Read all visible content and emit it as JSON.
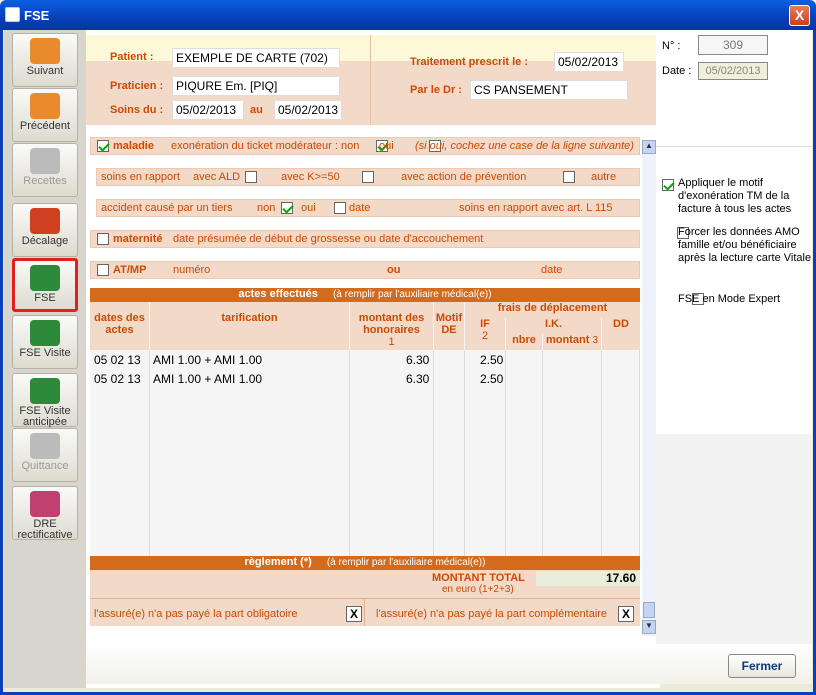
{
  "window": {
    "title": "FSE",
    "close": "X"
  },
  "sidebar": [
    {
      "label": "Suivant",
      "icon": "arrow-right-icon",
      "disabled": false
    },
    {
      "label": "Précédent",
      "icon": "arrow-left-icon",
      "disabled": false
    },
    {
      "label": "Recettes",
      "icon": "euro-icon",
      "disabled": true
    },
    {
      "label": "Décalage",
      "icon": "calendar-icon",
      "disabled": false
    },
    {
      "label": "FSE",
      "icon": "card-reader-icon",
      "disabled": false,
      "selected": true
    },
    {
      "label": "FSE Visite",
      "icon": "card-car-icon",
      "disabled": false
    },
    {
      "label": "FSE Visite anticipée",
      "icon": "card-car-forward-icon",
      "disabled": false
    },
    {
      "label": "Quittance",
      "icon": "receipt-icon",
      "disabled": true
    },
    {
      "label": "DRE rectificative",
      "icon": "document-pen-icon",
      "disabled": false
    }
  ],
  "header": {
    "patient_label": "Patient :",
    "patient": "EXEMPLE DE CARTE (702)",
    "praticien_label": "Praticien :",
    "praticien": "PIQURE Em. [PIQ]",
    "soins_label": "Soins du :",
    "soins_from": "05/02/2013",
    "au_label": "au",
    "soins_to": "05/02/2013",
    "traitement_label": "Traitement prescrit le :",
    "traitement": "05/02/2013",
    "dr_label": "Par le Dr :",
    "dr": "CS PANSEMENT"
  },
  "meta": {
    "num_label": "N° :",
    "num": "309",
    "date_label": "Date :",
    "date": "05/02/2013"
  },
  "maladie": {
    "label": "maladie",
    "exo": "exonération du ticket modérateur : non",
    "oui": "oui",
    "hint": "(si oui, cochez une case de la ligne suivante)"
  },
  "soins": {
    "label": "soins en rapport",
    "ald": "avec ALD",
    "k50": "avec K>=50",
    "prev": "avec action de prévention",
    "autre": "autre"
  },
  "accident": {
    "label": "accident causé par un tiers",
    "non": "non",
    "oui": "oui",
    "date": "date",
    "l115": "soins en rapport avec art. L 115"
  },
  "maternite": {
    "label": "maternité",
    "desc": "date présumée de début de grossesse ou date d'accouchement"
  },
  "atmp": {
    "label": "AT/MP",
    "numero": "numéro",
    "ou": "ou",
    "date": "date"
  },
  "actes": {
    "title": "actes effectués",
    "subtitle": "(à remplir par l'auxiliaire médical(e))",
    "col_dates": "dates des actes",
    "col_tarif": "tarification",
    "col_montant": "montant des honoraires",
    "col_montant_n": "1",
    "col_motif": "Motif DE",
    "col_frais": "frais de déplacement",
    "col_if": "IF",
    "col_if_n": "2",
    "col_ik": "I.K.",
    "col_nbre": "nbre",
    "col_ikm": "montant",
    "col_ikm_n": "3",
    "col_dd": "DD",
    "rows": [
      {
        "date": "05 02 13",
        "tarif": "AMI 1.00 +  AMI 1.00",
        "montant": "6.30",
        "if": "2.50"
      },
      {
        "date": "05 02 13",
        "tarif": "AMI 1.00 +  AMI 1.00",
        "montant": "6.30",
        "if": "2.50"
      }
    ]
  },
  "reglement": {
    "title": "règlement (*)",
    "subtitle": "(à remplir par l'auxiliaire médical(e))",
    "total_label": "MONTANT TOTAL",
    "total_sub": "en euro (1+2+3)",
    "total": "17.60",
    "oblig": "l'assuré(e) n'a pas payé la part obligatoire",
    "compl": "l'assuré(e) n'a pas payé la part complémentaire",
    "x": "X"
  },
  "options": [
    {
      "label": "Appliquer le motif d'exonération TM de la facture à tous les actes",
      "checked": true
    },
    {
      "label": "Forcer les données AMO famille et/ou bénéficiaire après la lecture carte Vitale",
      "checked": false
    },
    {
      "label": "FSE en Mode Expert",
      "checked": false
    }
  ],
  "footer": {
    "fermer": "Fermer"
  }
}
